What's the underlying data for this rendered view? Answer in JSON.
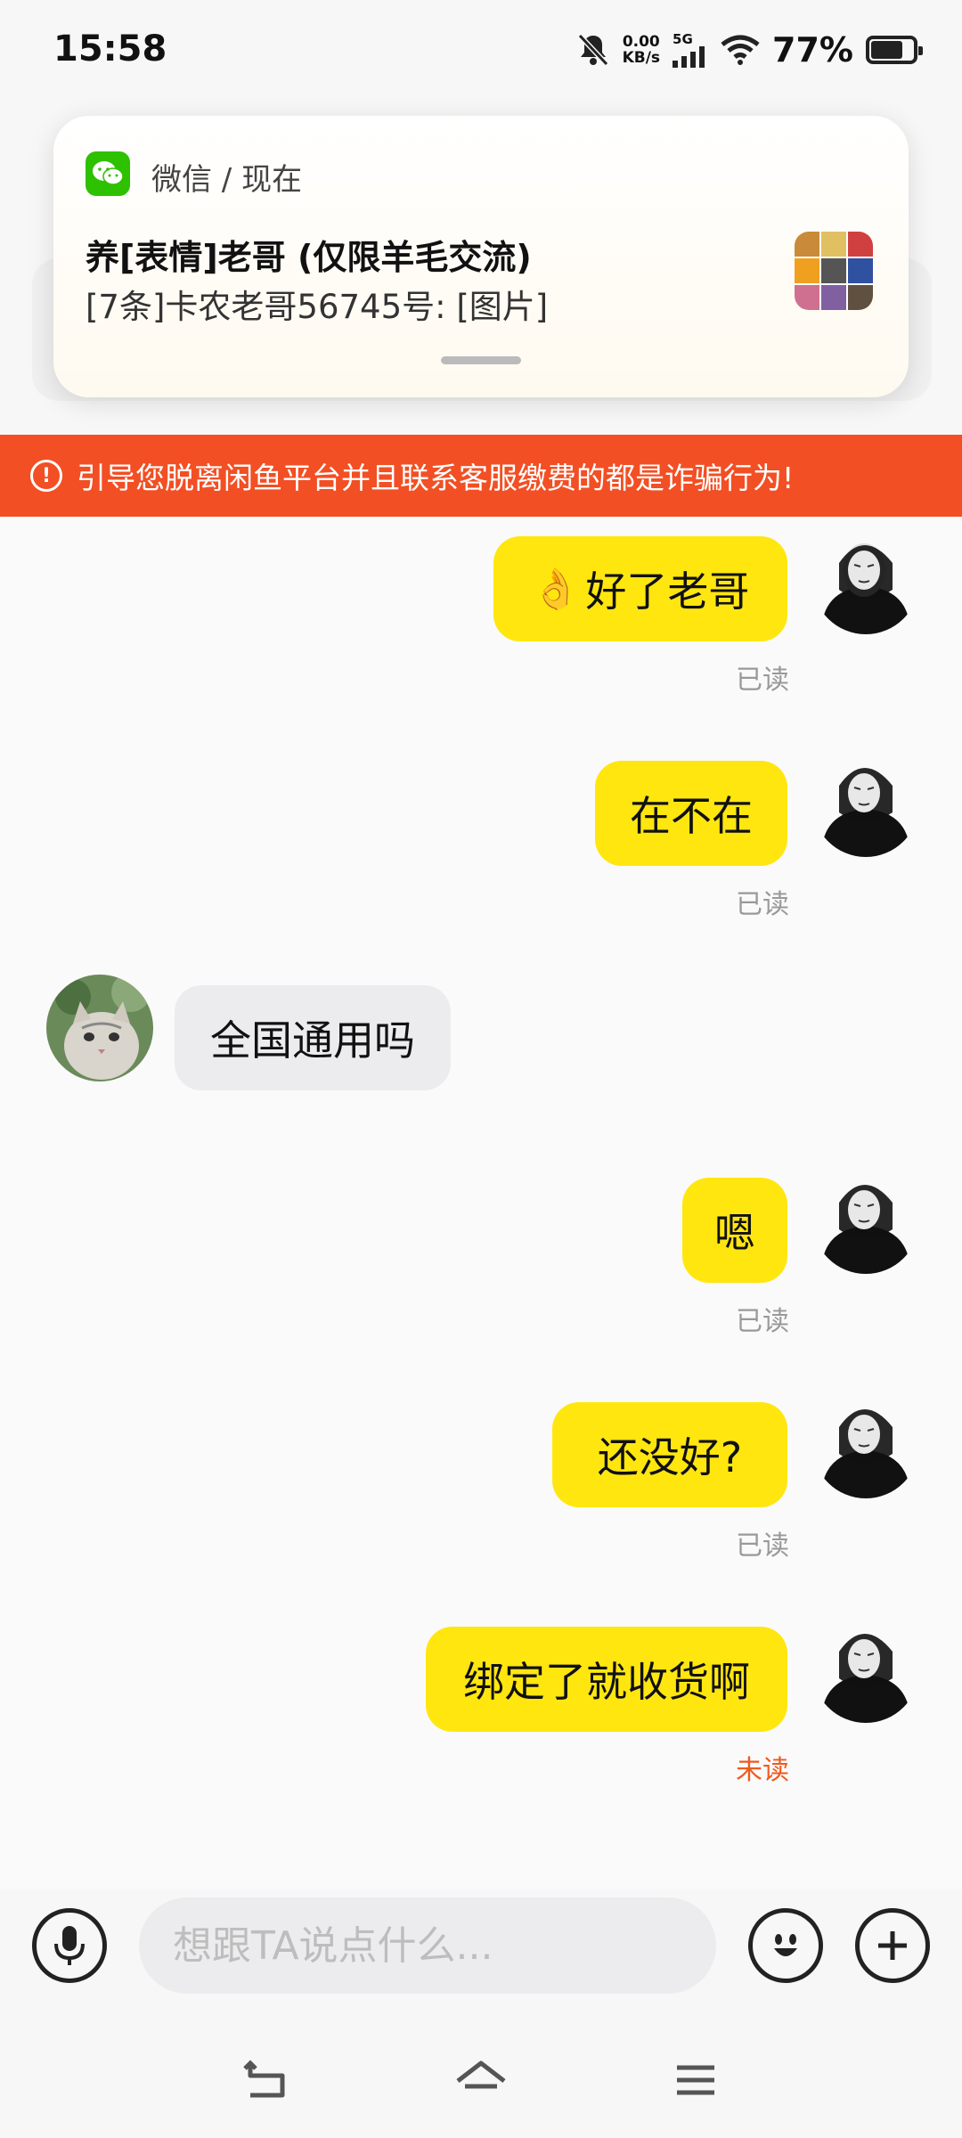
{
  "status_bar": {
    "time": "15:58",
    "net_speed_value": "0.00",
    "net_speed_unit": "KB/s",
    "network": "5G",
    "battery_percent": "77%"
  },
  "notification": {
    "app_line": "微信 / 现在",
    "title": "养[表情]老哥 (仅限羊毛交流)",
    "body": "[7条]卡农老哥56745号: [图片]"
  },
  "warning_banner": {
    "text": "引导您脱离闲鱼平台并且联系客服缴费的都是诈骗行为!"
  },
  "messages": [
    {
      "sender": "me",
      "text": "好了老哥",
      "emoji": "ok-hand",
      "status": "已读"
    },
    {
      "sender": "me",
      "text": "在不在",
      "status": "已读"
    },
    {
      "sender": "them",
      "text": "全国通用吗"
    },
    {
      "sender": "me",
      "text": "嗯",
      "status": "已读"
    },
    {
      "sender": "me",
      "text": "还没好?",
      "status": "已读"
    },
    {
      "sender": "me",
      "text": "绑定了就收货啊",
      "status": "未读"
    }
  ],
  "input_bar": {
    "placeholder": "想跟TA说点什么..."
  },
  "colors": {
    "my_bubble": "#ffe60f",
    "their_bubble": "#ececee",
    "warning": "#f24f24",
    "unread": "#ef5a1e"
  }
}
